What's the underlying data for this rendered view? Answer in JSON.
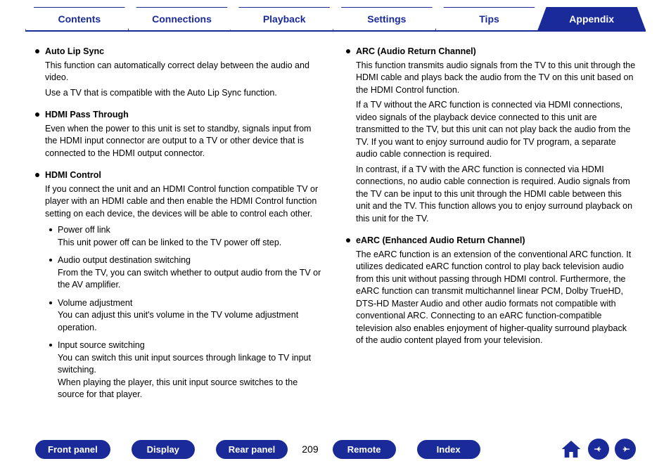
{
  "tabs": {
    "items": [
      {
        "label": "Contents"
      },
      {
        "label": "Connections"
      },
      {
        "label": "Playback"
      },
      {
        "label": "Settings"
      },
      {
        "label": "Tips"
      },
      {
        "label": "Appendix"
      }
    ],
    "active_index": 5
  },
  "left_column": {
    "auto_lip_sync": {
      "title": "Auto Lip Sync",
      "p1": "This function can automatically correct delay between the audio and video.",
      "p2": "Use a TV that is compatible with the Auto Lip Sync function."
    },
    "hdmi_pass": {
      "title": "HDMI Pass Through",
      "p1": "Even when the power to this unit is set to standby, signals input from the HDMI input connector are output to a TV or other device that is connected to the HDMI output connector."
    },
    "hdmi_control": {
      "title": "HDMI Control",
      "intro": "If you connect the unit and an HDMI Control function compatible TV or player with an HDMI cable and then enable the HDMI Control function setting on each device, the devices will be able to control each other.",
      "sub1_title": "Power off link",
      "sub1_body": "This unit power off can be linked to the TV power off step.",
      "sub2_title": "Audio output destination switching",
      "sub2_body": "From the TV, you can switch whether to output audio from the TV or the AV amplifier.",
      "sub3_title": "Volume adjustment",
      "sub3_body": "You can adjust this unit's volume in the TV volume adjustment operation.",
      "sub4_title": "Input source switching",
      "sub4_body1": "You can switch this unit input sources through linkage to TV input switching.",
      "sub4_body2": "When playing the player, this unit input source switches to the source for that player."
    }
  },
  "right_column": {
    "arc": {
      "title": "ARC (Audio Return Channel)",
      "p1": "This function transmits audio signals from the TV to this unit through the HDMI cable and plays back the audio from the TV on this unit based on the HDMI Control function.",
      "p2": "If a TV without the ARC function is connected via HDMI connections, video signals of the playback device connected to this unit are transmitted to the TV, but this unit can not play back the audio from the TV. If you want to enjoy surround audio for TV program, a separate audio cable connection is required.",
      "p3": "In contrast, if a TV with the ARC function is connected via HDMI connections, no audio cable connection is required. Audio signals from the TV can be input to this unit through the HDMI cable between this unit and the TV. This function allows you to enjoy surround playback on this unit for the TV."
    },
    "earc": {
      "title": "eARC (Enhanced Audio Return Channel)",
      "p1": "The eARC function is an extension of the conventional ARC function. It utilizes dedicated eARC function control to play back television audio from this unit without passing through HDMI control. Furthermore, the eARC function can transmit multichannel linear PCM, Dolby TrueHD, DTS-HD Master Audio and other audio formats not compatible with conventional ARC. Connecting to an eARC function-compatible television also enables enjoyment of higher-quality surround playback of the audio content played from your television."
    }
  },
  "footer": {
    "buttons": {
      "front_panel": "Front panel",
      "display": "Display",
      "rear_panel": "Rear panel",
      "remote": "Remote",
      "index": "Index"
    },
    "page": "209"
  }
}
